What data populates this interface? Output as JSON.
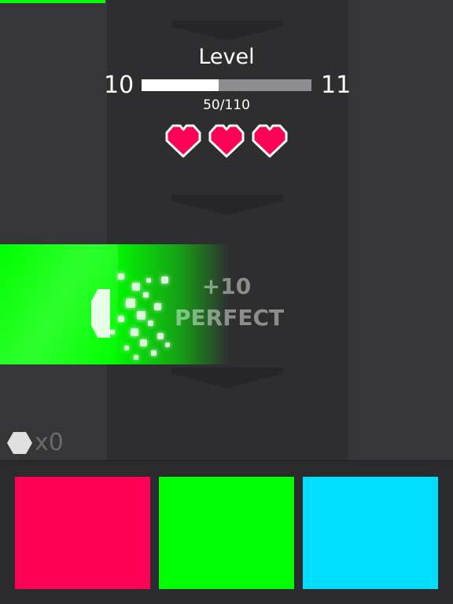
{
  "level": {
    "title": "Level",
    "current": "10",
    "next": "11",
    "progress_text": "50/110",
    "progress_fraction": 0.4545
  },
  "lives": {
    "count": 3,
    "color": "#ff0055"
  },
  "judgement": {
    "points": "+10",
    "label": "PERFECT"
  },
  "gems": {
    "icon": "hexagon-gem-icon",
    "count": "x0"
  },
  "colors": {
    "red": "#ff0055",
    "green": "#00ff00",
    "blue": "#00ddff",
    "background": "#2b2b2d"
  },
  "controls": [
    {
      "name": "red-color-pad",
      "color": "#ff0055"
    },
    {
      "name": "green-color-pad",
      "color": "#00ff00"
    },
    {
      "name": "blue-color-pad",
      "color": "#00ddff"
    }
  ]
}
